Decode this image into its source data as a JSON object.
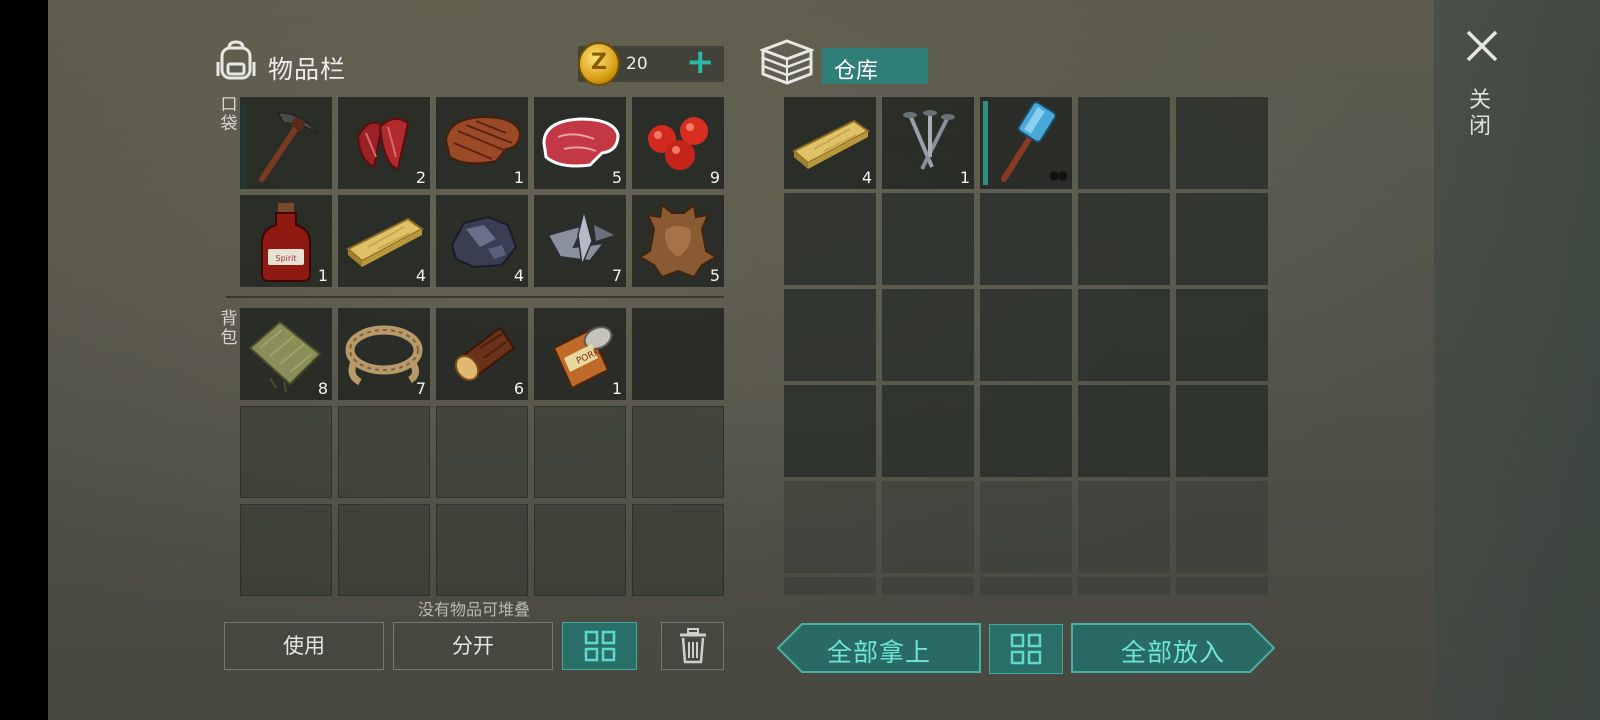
{
  "inventory": {
    "title": "物品栏",
    "coins": "20",
    "pocket_label": "口袋",
    "backpack_label": "背包",
    "pocket_items": [
      {
        "icon": "pickaxe-icon",
        "count": ""
      },
      {
        "icon": "raw-meat-strips-icon",
        "count": "2"
      },
      {
        "icon": "cooked-steak-icon",
        "count": "1"
      },
      {
        "icon": "raw-steak-icon",
        "count": "5"
      },
      {
        "icon": "red-berries-icon",
        "count": "9"
      },
      {
        "icon": "spirit-bottle-icon",
        "count": "1"
      },
      {
        "icon": "wood-plank-icon",
        "count": "4"
      },
      {
        "icon": "iron-ore-icon",
        "count": "4"
      },
      {
        "icon": "metal-scrap-icon",
        "count": "7"
      },
      {
        "icon": "animal-hide-icon",
        "count": "5"
      }
    ],
    "backpack_items": [
      {
        "icon": "cloth-icon",
        "count": "8"
      },
      {
        "icon": "rope-icon",
        "count": "7"
      },
      {
        "icon": "log-icon",
        "count": "6"
      },
      {
        "icon": "canned-food-icon",
        "count": "1"
      }
    ],
    "hint": "没有物品可堆叠",
    "use_label": "使用",
    "split_label": "分开"
  },
  "storage": {
    "tab_label": "仓库",
    "items": [
      {
        "icon": "wood-plank-icon",
        "count": "4"
      },
      {
        "icon": "nails-icon",
        "count": "1"
      },
      {
        "icon": "hammer-icon",
        "count": ""
      }
    ],
    "take_all_label": "全部拿上",
    "put_all_label": "全部放入"
  },
  "close_label": "关闭",
  "colors": {
    "accent": "#2d8f86",
    "accent_text": "#6fe5d8",
    "coin": "#d9a016"
  }
}
